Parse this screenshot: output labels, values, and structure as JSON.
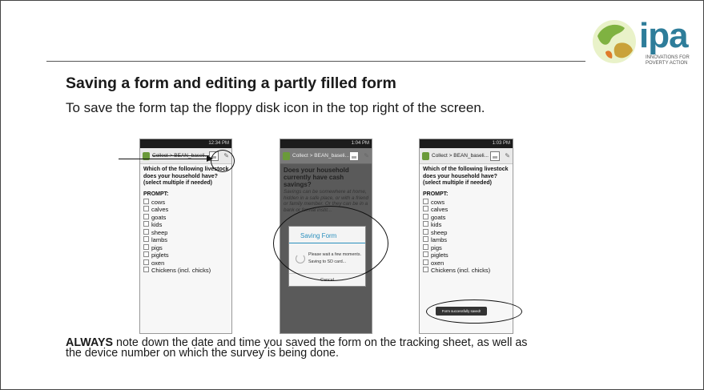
{
  "slide": {
    "title": "Saving a form and editing a partly filled form",
    "subtitle": "To save the form tap the floppy disk icon in the top right of the screen.",
    "note_bold": "ALWAYS",
    "note_line1": " note down the date and time you saved the form on the tracking sheet, as well as",
    "note_line2": "the device number on which the survey is being done."
  },
  "logo": {
    "text": "ipa",
    "tagline_line1": "INNOVATIONS FOR",
    "tagline_line2": "POVERTY ACTION",
    "color": "#2e7d9a"
  },
  "phone1": {
    "time": "12:34 PM",
    "crumb": "Collect > BEAN_baseli...",
    "question": "Which of the following livestock does your household have? (select multiple if needed)",
    "prompt": "PROMPT:",
    "options": [
      "cows",
      "calves",
      "goats",
      "kids",
      "sheep",
      "lambs",
      "pigs",
      "piglets",
      "oxen",
      "Chickens (incl. chicks)"
    ]
  },
  "phone2": {
    "time": "1:04 PM",
    "crumb": "Collect > BEAN_baseli...",
    "question": "Does your household currently have cash savings?",
    "hint": "Savings can be somewhere at home, hidden in a safe place, or with a friend or family member. Or they can be in a bank or formal instit...",
    "dialog_title": "Saving Form",
    "dialog_msg1": "Please wait a few moments.",
    "dialog_msg2": "Saving to SD card...",
    "dialog_cancel": "Cancel"
  },
  "phone3": {
    "time": "1:03 PM",
    "crumb": "Collect > BEAN_baseli...",
    "question": "Which of the following livestock does your household have? (select multiple if needed)",
    "prompt": "PROMPT:",
    "options": [
      "cows",
      "calves",
      "goats",
      "kids",
      "sheep",
      "lambs",
      "pigs",
      "piglets",
      "oxen",
      "Chickens (incl. chicks)"
    ],
    "toast": "Form successfully saved!"
  }
}
